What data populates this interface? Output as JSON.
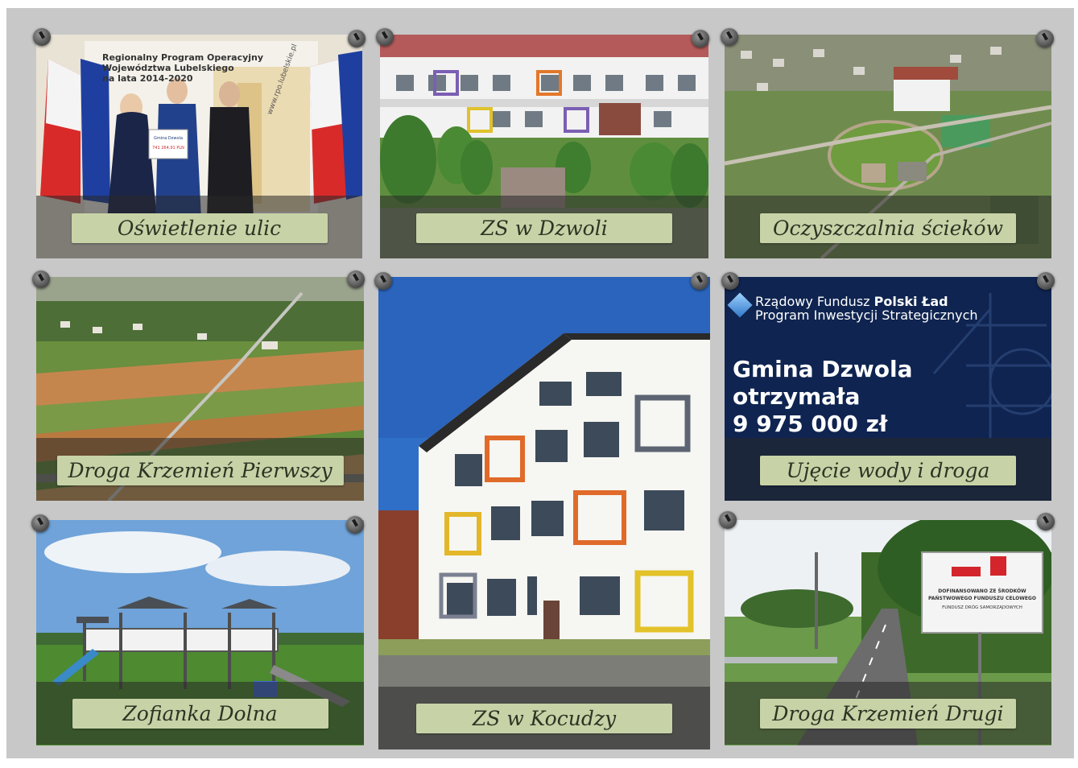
{
  "tiles": [
    {
      "id": "t1",
      "label": "Oświetlenie ulic",
      "banner": [
        "Regionalny Program Operacyjny",
        "Województwa Lubelskiego",
        "na lata 2014-2020"
      ],
      "site": "www.rpo.lubelskie.pl",
      "check_title": "Gmina Dzwola",
      "check_amount": "741 264,91 PLN"
    },
    {
      "id": "t2",
      "label": "ZS w Dzwoli"
    },
    {
      "id": "t3",
      "label": "Oczyszczalnia ścieków"
    },
    {
      "id": "t4",
      "label": "Droga Krzemień Pierwszy"
    },
    {
      "id": "t5",
      "label": "ZS w Kocudzy"
    },
    {
      "id": "t6",
      "label": "Ujęcie wody i droga",
      "header_line1_regular": "Rządowy Fundusz ",
      "header_line1_bold": "Polski Ład",
      "header_line2": "Program Inwestycji Strategicznych",
      "headline": [
        "Gmina Dzwola",
        "otrzymała",
        "9 975 000 zł"
      ]
    },
    {
      "id": "t7",
      "label": "Zofianka Dolna"
    },
    {
      "id": "t8",
      "label": "Droga Krzemień Drugi",
      "sign_lines": [
        "DOFINANSOWANO ZE ŚRODKÓW",
        "PAŃSTWOWEGO FUNDUSZU CELOWEGO",
        "FUNDUSZ DRÓG SAMORZĄDOWYCH"
      ]
    }
  ],
  "colors": {
    "board": "#c8c8c8",
    "label_bg": "#c7d3a7",
    "label_text": "#2d3424",
    "pin": "#5a5a5a"
  }
}
